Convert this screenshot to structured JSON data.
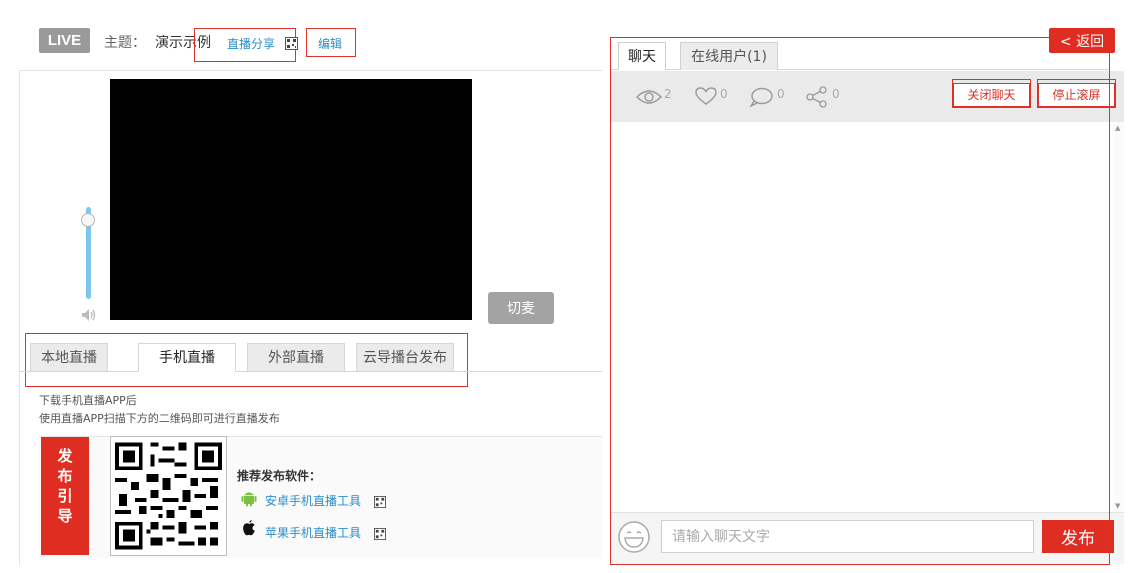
{
  "header": {
    "live_badge": "LIVE",
    "topic_label": "主题：",
    "topic_value": "演示示例",
    "share_link": "直播分享",
    "edit_link": "编辑"
  },
  "player": {
    "switch_mic": "切麦"
  },
  "source_tabs": [
    {
      "label": "本地直播",
      "active": false
    },
    {
      "label": "手机直播",
      "active": true
    },
    {
      "label": "外部直播",
      "active": false
    },
    {
      "label": "云导播台发布",
      "active": false
    }
  ],
  "mobile": {
    "hint_line1": "下载手机直播APP后",
    "hint_line2": "使用直播APP扫描下方的二维码即可进行直播发布",
    "guide_label": [
      "发",
      "布",
      "引",
      "导"
    ],
    "recommend_title": "推荐发布软件：",
    "android_app": "安卓手机直播工具",
    "ios_app": "苹果手机直播工具"
  },
  "chat": {
    "back_label": "< 返回",
    "tab_chat": "聊天",
    "tab_users": "在线用户(1)",
    "views": "2",
    "likes": "0",
    "comments": "0",
    "shares": "0",
    "close_chat": "关闭聊天",
    "stop_scroll": "停止滚屏",
    "input_placeholder": "请输入聊天文字",
    "send_label": "发布"
  },
  "icons": {
    "eye": "eye-icon",
    "heart": "heart-icon",
    "comment": "comment-icon",
    "share": "share-icon",
    "qr": "qr-code-icon",
    "android": "android-icon",
    "apple": "apple-icon",
    "speaker": "speaker-icon",
    "smile": "smile-icon"
  },
  "colors": {
    "accent_red": "#e02d22",
    "link_blue": "#2a8fc9"
  }
}
